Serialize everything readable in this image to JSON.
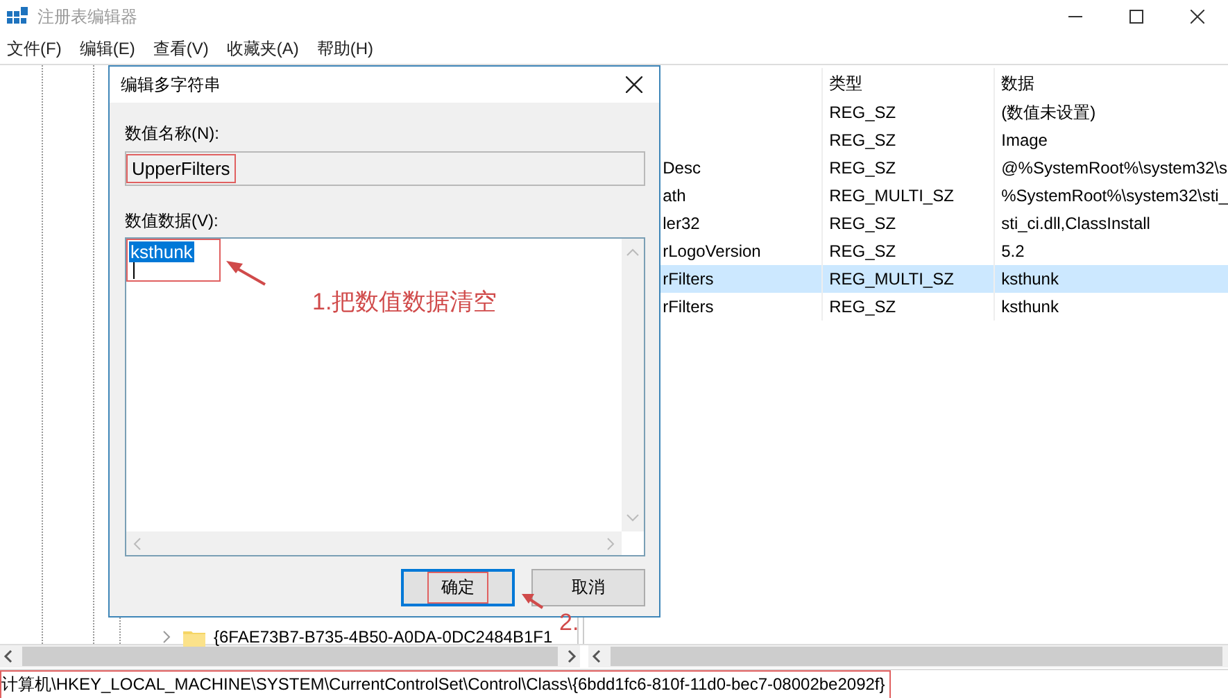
{
  "window": {
    "title": "注册表编辑器"
  },
  "menu": [
    {
      "label": "文件(F)"
    },
    {
      "label": "编辑(E)"
    },
    {
      "label": "查看(V)"
    },
    {
      "label": "收藏夹(A)"
    },
    {
      "label": "帮助(H)"
    }
  ],
  "tree": {
    "items": [
      {
        "label": "{6FAE73B7-B735-4B50-A0DA-0DC2484B1F1",
        "expanded": false
      }
    ]
  },
  "list": {
    "columns": [
      {
        "label": "类型"
      },
      {
        "label": "数据"
      }
    ],
    "rows": [
      {
        "name": "",
        "type": "REG_SZ",
        "data": "(数值未设置)",
        "selected": false
      },
      {
        "name": "",
        "type": "REG_SZ",
        "data": "Image",
        "selected": false
      },
      {
        "name": "Desc",
        "type": "REG_SZ",
        "data": "@%SystemRoot%\\system32\\s",
        "selected": false
      },
      {
        "name": "ath",
        "type": "REG_MULTI_SZ",
        "data": "%SystemRoot%\\system32\\sti_",
        "selected": false
      },
      {
        "name": "ler32",
        "type": "REG_SZ",
        "data": "sti_ci.dll,ClassInstall",
        "selected": false
      },
      {
        "name": "rLogoVersion",
        "type": "REG_SZ",
        "data": "5.2",
        "selected": false
      },
      {
        "name": "rFilters",
        "type": "REG_MULTI_SZ",
        "data": "ksthunk",
        "selected": true
      },
      {
        "name": "rFilters",
        "type": "REG_SZ",
        "data": "ksthunk",
        "selected": false
      }
    ]
  },
  "status_bar": {
    "path": "计算机\\HKEY_LOCAL_MACHINE\\SYSTEM\\CurrentControlSet\\Control\\Class\\{6bdd1fc6-810f-11d0-bec7-08002be2092f}",
    "marked": true
  },
  "dialog": {
    "title": "编辑多字符串",
    "name_label": "数值名称(N):",
    "name_value": "UpperFilters",
    "name_marked": true,
    "data_label": "数值数据(V):",
    "data_value": "ksthunk",
    "data_value_selected": true,
    "data_marked": true,
    "buttons": [
      {
        "label": "确定",
        "focused": true,
        "marked": true
      },
      {
        "label": "取消",
        "focused": false,
        "marked": false
      }
    ]
  },
  "annotations": [
    {
      "kind": "note",
      "text": "1.把数值数据清空"
    },
    {
      "kind": "note",
      "text": "2."
    }
  ]
}
